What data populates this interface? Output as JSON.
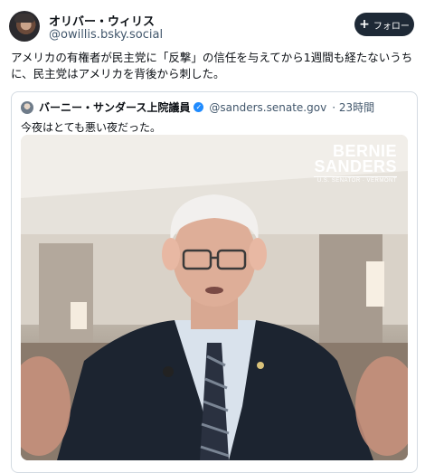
{
  "author": {
    "display_name": "オリバー・ウィリス",
    "handle": "@owillis.bsky.social"
  },
  "follow_button": {
    "label": "フォロー"
  },
  "post": {
    "text": "アメリカの有権者が民主党に「反撃」の信任を与えてから1週間も経たないうちに、民主党はアメリカを背後から刺した。"
  },
  "quoted": {
    "display_name": "バーニー・サンダース上院議員",
    "handle": "@sanders.senate.gov",
    "time": "23時間",
    "text": "今夜はとても悪い夜だった。",
    "video_brand": {
      "line1": "BERNIE",
      "line2": "SANDERS",
      "line3": "U.S. SENATOR · VERMONT"
    }
  },
  "icons": [
    "plus-icon",
    "verified-badge-icon"
  ]
}
